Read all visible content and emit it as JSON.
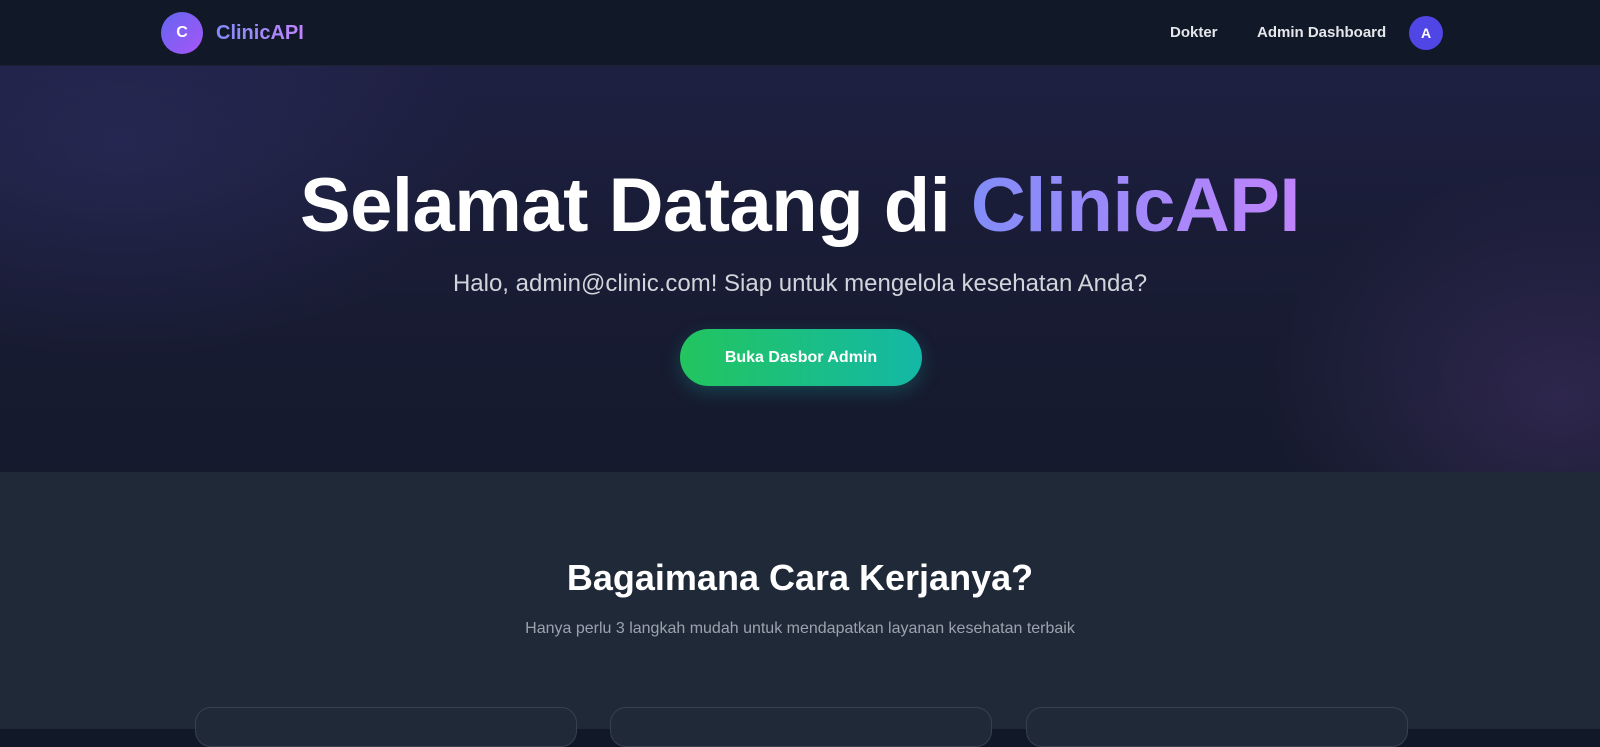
{
  "navbar": {
    "logo_letter": "C",
    "brand_name": "ClinicAPI",
    "links": {
      "dokter": "Dokter",
      "admin_dashboard": "Admin Dashboard"
    },
    "avatar_letter": "A"
  },
  "hero": {
    "title_prefix": "Selamat Datang di ",
    "title_accent": "ClinicAPI",
    "subtitle": "Halo, admin@clinic.com! Siap untuk mengelola kesehatan Anda?",
    "cta_label": "Buka Dasbor Admin"
  },
  "how_it_works": {
    "title": "Bagaimana Cara Kerjanya?",
    "subtitle": "Hanya perlu 3 langkah mudah untuk mendapatkan layanan kesehatan terbaik"
  },
  "colors": {
    "background": "#111827",
    "accent_gradient_start": "#818cf8",
    "accent_gradient_end": "#c084fc",
    "cta_gradient_start": "#22c55e",
    "cta_gradient_end": "#14b8a6",
    "avatar": "#4f46e5"
  }
}
